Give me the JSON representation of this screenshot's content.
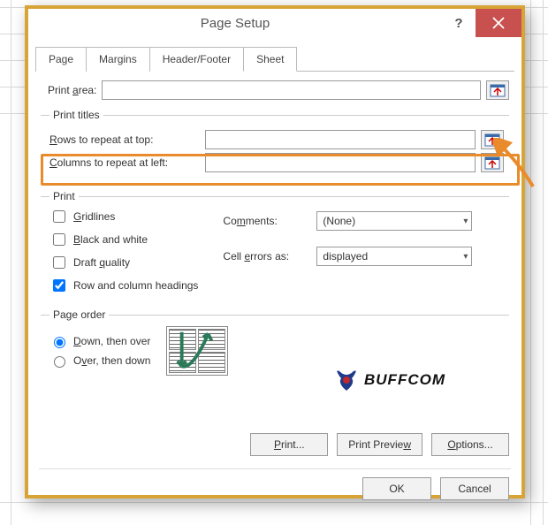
{
  "titlebar": {
    "title": "Page Setup",
    "help": "?",
    "close_aria": "Close"
  },
  "tabs": {
    "page": "Page",
    "margins": "Margins",
    "header_footer": "Header/Footer",
    "sheet": "Sheet"
  },
  "print_area": {
    "label": "Print area:",
    "value": "",
    "underline": "a"
  },
  "print_titles": {
    "legend": "Print titles",
    "rows": {
      "label": "Rows to repeat at top:",
      "value": "",
      "underline": "R"
    },
    "cols": {
      "label": "Columns to repeat at left:",
      "value": "",
      "underline": "C"
    }
  },
  "print": {
    "legend": "Print",
    "gridlines": {
      "label": "Gridlines",
      "checked": false,
      "underline": "G"
    },
    "bw": {
      "label": "Black and white",
      "checked": false,
      "underline": "B"
    },
    "draft": {
      "label": "Draft quality",
      "checked": false,
      "underline": "q"
    },
    "headings": {
      "label": "Row and column headings",
      "checked": true
    },
    "comments_label": "Comments:",
    "comments_value": "(None)",
    "cell_errors_label": "Cell errors as:",
    "cell_errors_value": "displayed",
    "comments_underline": "m",
    "errors_underline": "e"
  },
  "page_order": {
    "legend": "Page order",
    "down": {
      "label": "Down, then over",
      "checked": true,
      "underline": "D"
    },
    "over": {
      "label": "Over, then down",
      "checked": false,
      "underline": "v"
    }
  },
  "buttons": {
    "print": "Print...",
    "preview": "Print Preview",
    "options": "Options...",
    "ok": "OK",
    "cancel": "Cancel",
    "print_u": "P",
    "preview_u": "w",
    "options_u": "O"
  },
  "watermark": {
    "text": "BUFFCOM"
  }
}
